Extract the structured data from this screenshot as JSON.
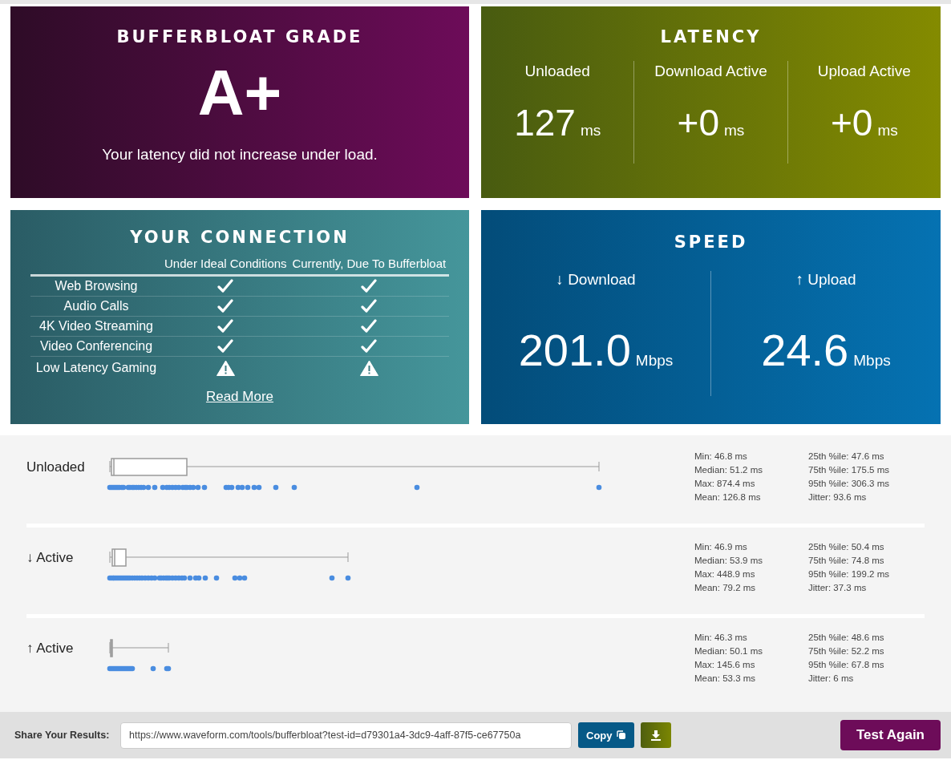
{
  "grade": {
    "title": "BUFFERBLOAT GRADE",
    "grade": "A+",
    "message": "Your latency did not increase under load."
  },
  "latency": {
    "title": "LATENCY",
    "columns": [
      {
        "label": "Unloaded",
        "value": "127",
        "unit": "ms"
      },
      {
        "label": "Download Active",
        "value": "+0",
        "unit": "ms"
      },
      {
        "label": "Upload Active",
        "value": "+0",
        "unit": "ms"
      }
    ]
  },
  "connection": {
    "title": "YOUR CONNECTION",
    "columns": [
      "Under Ideal Conditions",
      "Currently, Due To Bufferbloat"
    ],
    "rows": [
      {
        "activity": "Web Browsing",
        "ideal_ok": true,
        "current_ok": true
      },
      {
        "activity": "Audio Calls",
        "ideal_ok": true,
        "current_ok": true
      },
      {
        "activity": "4K Video Streaming",
        "ideal_ok": true,
        "current_ok": true
      },
      {
        "activity": "Video Conferencing",
        "ideal_ok": true,
        "current_ok": true
      },
      {
        "activity": "Low Latency Gaming",
        "ideal_ok": false,
        "current_ok": false
      }
    ],
    "link": "Read More"
  },
  "speed": {
    "title": "SPEED",
    "columns": [
      {
        "label": "↓ Download",
        "value": "201.0",
        "unit": "Mbps"
      },
      {
        "label": "↑ Upload",
        "value": "24.6",
        "unit": "Mbps"
      }
    ]
  },
  "latency_rows": [
    {
      "label": "Unloaded",
      "stats": [
        "Min: 46.8 ms",
        "Median: 51.2 ms",
        "Max: 874.4 ms",
        "Mean: 126.8 ms",
        "25th %ile: 47.6 ms",
        "75th %ile: 175.5 ms",
        "95th %ile: 306.3 ms",
        "Jitter: 93.6 ms"
      ]
    },
    {
      "label": "↓ Active",
      "stats": [
        "Min: 46.9 ms",
        "Median: 53.9 ms",
        "Max: 448.9 ms",
        "Mean: 79.2 ms",
        "25th %ile: 50.4 ms",
        "75th %ile: 74.8 ms",
        "95th %ile: 199.2 ms",
        "Jitter: 37.3 ms"
      ]
    },
    {
      "label": "↑ Active",
      "stats": [
        "Min: 46.3 ms",
        "Median: 50.1 ms",
        "Max: 145.6 ms",
        "Mean: 53.3 ms",
        "25th %ile: 48.6 ms",
        "75th %ile: 52.2 ms",
        "95th %ile: 67.8 ms",
        "Jitter: 6 ms"
      ]
    }
  ],
  "share": {
    "label": "Share Your Results:",
    "url": "https://www.waveform.com/tools/bufferbloat?test-id=d79301a4-3dc9-4aff-87f5-ce67750a",
    "copy": "Copy",
    "button": "Test Again"
  }
}
